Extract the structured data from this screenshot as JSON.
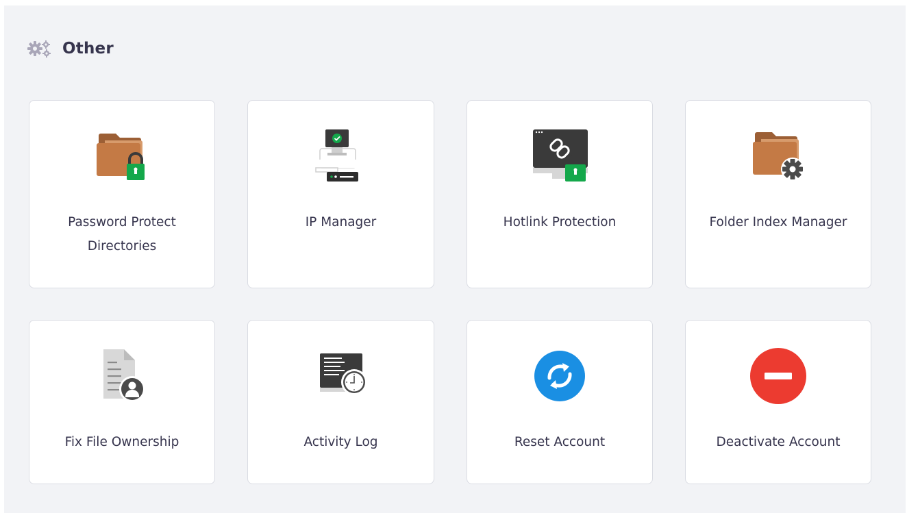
{
  "section": {
    "title": "Other",
    "icon": "gears-icon"
  },
  "cards": [
    {
      "label": "Password Protect Directories",
      "icon": "folder-lock-icon"
    },
    {
      "label": "IP Manager",
      "icon": "ip-manager-icon"
    },
    {
      "label": "Hotlink Protection",
      "icon": "hotlink-lock-icon"
    },
    {
      "label": "Folder Index Manager",
      "icon": "folder-gear-icon"
    },
    {
      "label": "Fix File Ownership",
      "icon": "file-user-icon"
    },
    {
      "label": "Activity Log",
      "icon": "activity-log-icon"
    },
    {
      "label": "Reset Account",
      "icon": "reset-icon"
    },
    {
      "label": "Deactivate Account",
      "icon": "deactivate-icon"
    }
  ],
  "colors": {
    "background": "#f2f3f6",
    "card": "#ffffff",
    "folder": "#c47a45",
    "lock_green": "#14a84b",
    "reset_blue": "#1a8fe3",
    "deactivate_red": "#ec3b30",
    "dark_gray": "#3a3a3a"
  }
}
